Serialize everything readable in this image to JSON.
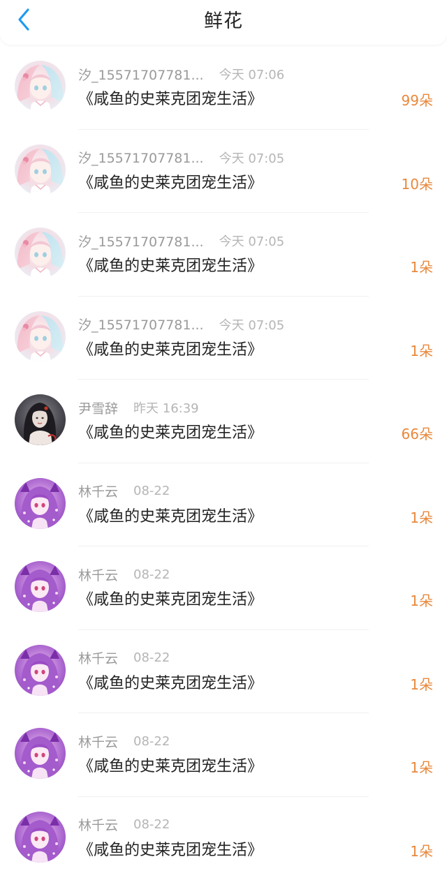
{
  "header": {
    "title": "鲜花",
    "back_icon": "chevron-left-icon",
    "accent_color": "#1e9bf0"
  },
  "records": [
    {
      "user": "汐_15571707781...",
      "time": "今天 07:06",
      "book": "《咸鱼的史莱克团宠生活》",
      "count": "99朵",
      "avatar": "anime-girl-pastel"
    },
    {
      "user": "汐_15571707781...",
      "time": "今天 07:05",
      "book": "《咸鱼的史莱克团宠生活》",
      "count": "10朵",
      "avatar": "anime-girl-pastel"
    },
    {
      "user": "汐_15571707781...",
      "time": "今天 07:05",
      "book": "《咸鱼的史莱克团宠生活》",
      "count": "1朵",
      "avatar": "anime-girl-pastel"
    },
    {
      "user": "汐_15571707781...",
      "time": "今天 07:05",
      "book": "《咸鱼的史莱克团宠生活》",
      "count": "1朵",
      "avatar": "anime-girl-pastel"
    },
    {
      "user": "尹雪辞",
      "time": "昨天 16:39",
      "book": "《咸鱼的史莱克团宠生活》",
      "count": "66朵",
      "avatar": "dark-portrait"
    },
    {
      "user": "林千云",
      "time": "08-22",
      "book": "《咸鱼的史莱克团宠生活》",
      "count": "1朵",
      "avatar": "purple-anime-girl"
    },
    {
      "user": "林千云",
      "time": "08-22",
      "book": "《咸鱼的史莱克团宠生活》",
      "count": "1朵",
      "avatar": "purple-anime-girl"
    },
    {
      "user": "林千云",
      "time": "08-22",
      "book": "《咸鱼的史莱克团宠生活》",
      "count": "1朵",
      "avatar": "purple-anime-girl"
    },
    {
      "user": "林千云",
      "time": "08-22",
      "book": "《咸鱼的史莱克团宠生活》",
      "count": "1朵",
      "avatar": "purple-anime-girl"
    },
    {
      "user": "林千云",
      "time": "08-22",
      "book": "《咸鱼的史莱克团宠生活》",
      "count": "1朵",
      "avatar": "purple-anime-girl"
    }
  ],
  "colors": {
    "count": "#e8883c",
    "username": "#9a9a9a",
    "time": "#b5b5b5",
    "title": "#222222"
  }
}
